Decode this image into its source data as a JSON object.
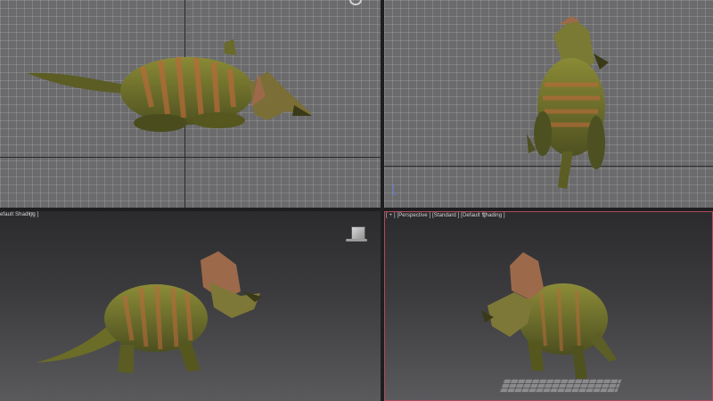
{
  "viewports": {
    "top": {
      "name": "top-viewport"
    },
    "front": {
      "name": "front-viewport"
    },
    "left": {
      "label": "efault Shading ]",
      "filter": "▽"
    },
    "perspective": {
      "label": "[ + ] [Perspective ] [Standard ] [Default Shading ]",
      "filter": "▽"
    }
  },
  "colors": {
    "viewport_grid_bg": "#6b6b6d",
    "viewport_dark_bg": "#2b2b2e",
    "active_border": "#b24a5c",
    "dino_body": "#7a7a2a",
    "dino_stripes": "#b86a3a",
    "frill": "#9c6a4a"
  },
  "icons": [
    "viewcube-icon",
    "compass-icon",
    "funnel-icon",
    "axis-gizmo-icon"
  ]
}
